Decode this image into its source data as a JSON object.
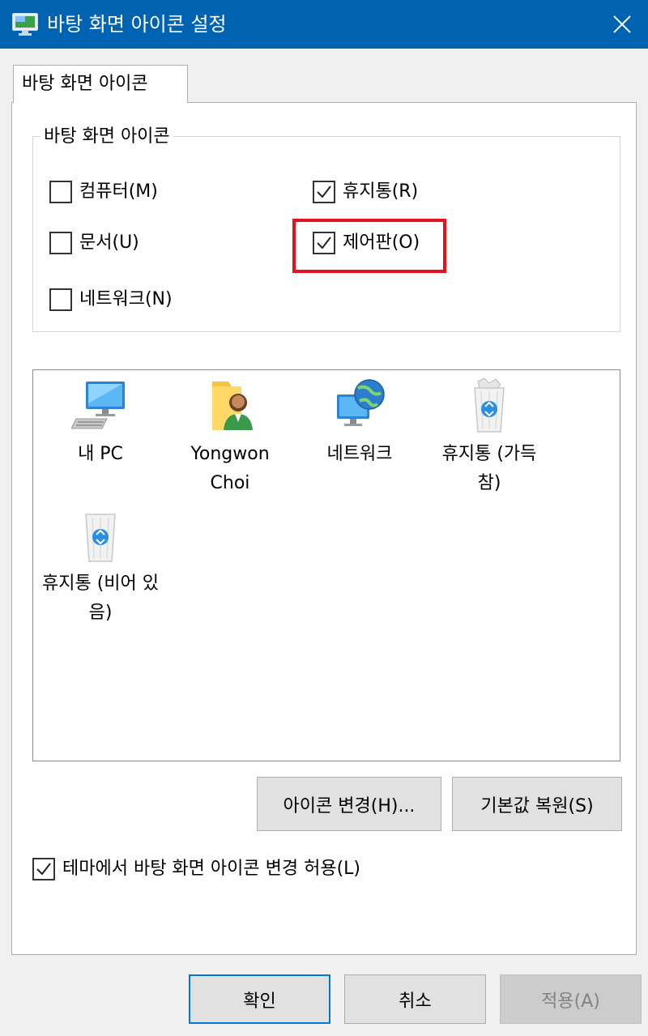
{
  "window": {
    "title": "바탕 화면 아이콘 설정"
  },
  "tab": {
    "label": "바탕 화면 아이콘"
  },
  "group": {
    "legend": "바탕 화면 아이콘",
    "checkboxes": [
      {
        "label": "컴퓨터(M)",
        "checked": false
      },
      {
        "label": "휴지통(R)",
        "checked": true
      },
      {
        "label": "문서(U)",
        "checked": false
      },
      {
        "label": "제어판(O)",
        "checked": true
      },
      {
        "label": "네트워크(N)",
        "checked": false
      }
    ]
  },
  "icons": [
    {
      "caption": "내 PC",
      "icon": "computer-icon"
    },
    {
      "caption": "Yongwon Choi",
      "icon": "user-folder-icon"
    },
    {
      "caption": "네트워크",
      "icon": "network-icon"
    },
    {
      "caption": "휴지통 (가득 참)",
      "icon": "recycle-bin-full-icon"
    },
    {
      "caption": "휴지통 (비어 있음)",
      "icon": "recycle-bin-empty-icon"
    }
  ],
  "buttons": {
    "change_icon": "아이콘 변경(H)...",
    "restore_default": "기본값 복원(S)",
    "ok": "확인",
    "cancel": "취소",
    "apply": "적용(A)"
  },
  "theme_checkbox": {
    "label": "테마에서 바탕 화면 아이콘 변경 허용(L)",
    "checked": true
  },
  "colors": {
    "titlebar": "#0063b1",
    "highlight": "#e8101a",
    "default_button_border": "#0078d7"
  }
}
